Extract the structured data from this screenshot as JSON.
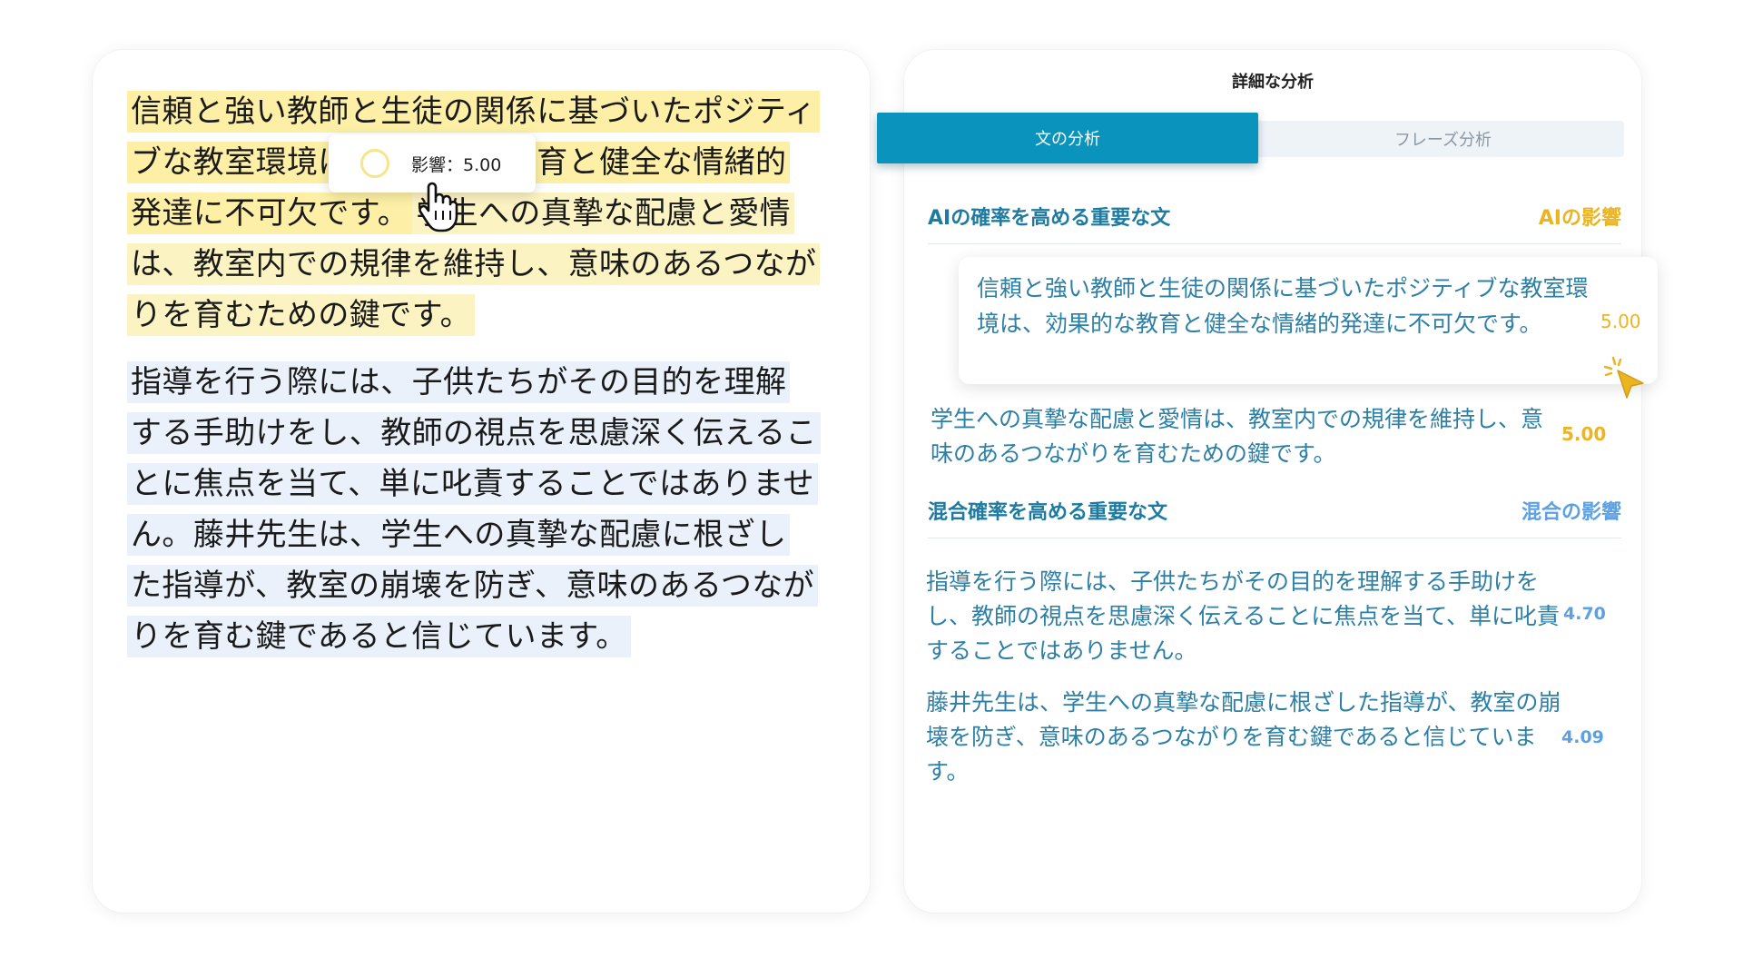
{
  "document": {
    "paragraph1": {
      "sentence1": "信頼と強い教師と生徒の関係に基づいたポジティブな教室環境は、効果的な教育と健全な情緒的発達に不可欠です。",
      "sentence2": "学生への真摯な配慮と愛情は、教室内での規律を維持し、意味のあるつながりを育むための鍵です。"
    },
    "paragraph2": "指導を行う際には、子供たちがその目的を理解する手助けをし、教師の視点を思慮深く伝えることに焦点を当て、単に叱責することではありません。藤井先生は、学生への真摯な配慮に根ざした指導が、教室の崩壊を防ぎ、意味のあるつながりを育む鍵であると信じています。"
  },
  "tooltip": {
    "text": "影響：5.00"
  },
  "panel": {
    "title": "詳細な分析",
    "tabs": {
      "sentence": "文の分析",
      "phrase": "フレーズ分析"
    },
    "ai_section": {
      "heading": "AIの確率を高める重要な文",
      "impact_label": "AIの影響",
      "rows": [
        {
          "text": "信頼と強い教師と生徒の関係に基づいたポジティブな教室環境は、効果的な教育と健全な情緒的発達に不可欠です。",
          "score": "5.00"
        },
        {
          "text": "学生への真摯な配慮と愛情は、教室内での規律を維持し、意味のあるつながりを育むための鍵です。",
          "score": "5.00"
        }
      ]
    },
    "mix_section": {
      "heading": "混合確率を高める重要な文",
      "impact_label": "混合の影響",
      "rows": [
        {
          "text": "指導を行う際には、子供たちがその目的を理解する手助けをし、教師の視点を思慮深く伝えることに焦点を当て、単に叱責することではありません。",
          "score": "4.70"
        },
        {
          "text": "藤井先生は、学生への真摯な配慮に根ざした指導が、教室の崩壊を防ぎ、意味のあるつながりを育む鍵であると信じています。",
          "score": "4.09"
        }
      ]
    }
  },
  "colors": {
    "ai_yellow": "#ebb421",
    "mix_blue": "#5da1e3",
    "tab_active": "#0a93bd",
    "text_teal": "#2d7fa5"
  },
  "icons": {
    "tooltip": "ring-icon",
    "pointer": "hand-cursor-icon",
    "click": "arrow-cursor-icon"
  }
}
